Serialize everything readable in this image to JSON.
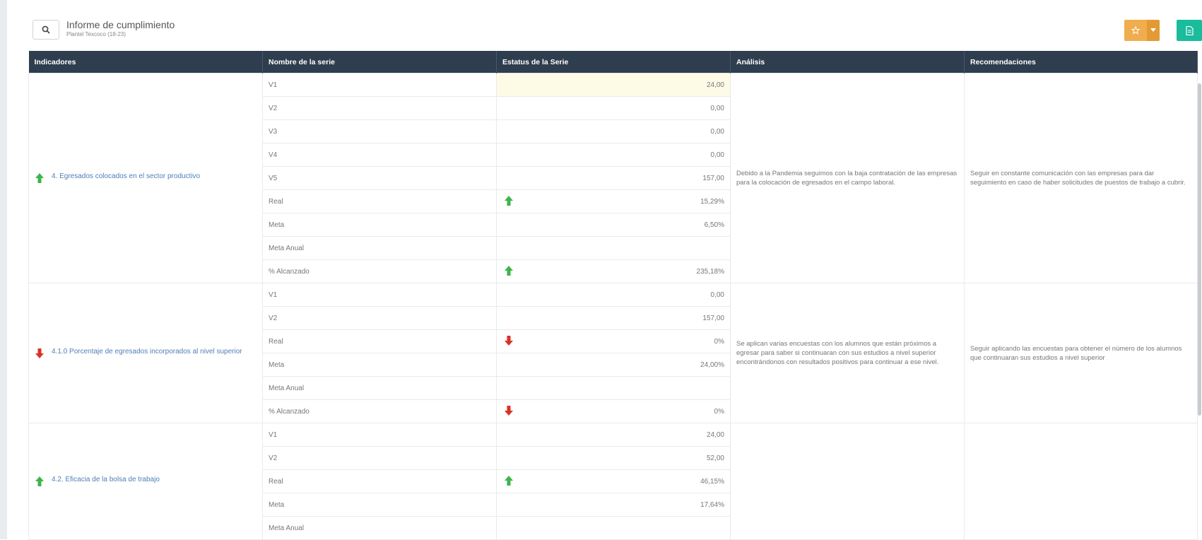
{
  "header": {
    "title": "Informe de cumplimiento",
    "subtitle": "Plantel Texcoco (18-23)"
  },
  "colors": {
    "header_bg": "#2f3e4e",
    "arrow_up": "#3bb54a",
    "arrow_down": "#d9322a",
    "star_button": "#f0ad4e",
    "doc_button": "#1abc9c",
    "link": "#4e7fb5"
  },
  "toolbar": {
    "search_icon": "search-icon",
    "star_icon": "star-icon",
    "caret_icon": "caret-down-icon",
    "doc_icon": "document-icon"
  },
  "table": {
    "columns": [
      "Indicadores",
      "Nombre de la serie",
      "Estatus de la Serie",
      "Análisis",
      "Recomendaciones"
    ],
    "groups": [
      {
        "indicator": "4. Egresados colocados en el sector productivo",
        "trend": "up",
        "analysis": "Debido a la Pandemia seguimos con la baja contratación de las empresas para la colocación de egresados en el campo laboral.",
        "recommendation": "Seguir en constante comunicación con las empresas para dar seguimiento en caso de haber solicitudes de puestos de trabajo a cubrir.",
        "rows": [
          {
            "serie": "V1",
            "value": "24,00",
            "status": "",
            "highlight": true
          },
          {
            "serie": "V2",
            "value": "0,00",
            "status": ""
          },
          {
            "serie": "V3",
            "value": "0,00",
            "status": ""
          },
          {
            "serie": "V4",
            "value": "0,00",
            "status": ""
          },
          {
            "serie": "V5",
            "value": "157,00",
            "status": ""
          },
          {
            "serie": "Real",
            "value": "15,29%",
            "status": "up"
          },
          {
            "serie": "Meta",
            "value": "6,50%",
            "status": ""
          },
          {
            "serie": "Meta Anual",
            "value": "",
            "status": ""
          },
          {
            "serie": "% Alcanzado",
            "value": "235,18%",
            "status": "up"
          }
        ]
      },
      {
        "indicator": "4.1.0 Porcentaje de egresados incorporados al nivel superior",
        "trend": "down",
        "analysis": "Se aplican varias encuestas con los alumnos que están próximos a egresar para saber si continuaran con sus estudios a nivel superior encontrándonos con resultados positivos para continuar a ese nivel.",
        "recommendation": "Seguir aplicando las encuestas para obtener el número de los alumnos que continuaran sus estudios a nivel superior",
        "rows": [
          {
            "serie": "V1",
            "value": "0,00",
            "status": ""
          },
          {
            "serie": "V2",
            "value": "157,00",
            "status": ""
          },
          {
            "serie": "Real",
            "value": "0%",
            "status": "down"
          },
          {
            "serie": "Meta",
            "value": "24,00%",
            "status": ""
          },
          {
            "serie": "Meta Anual",
            "value": "",
            "status": ""
          },
          {
            "serie": "% Alcanzado",
            "value": "0%",
            "status": "down"
          }
        ]
      },
      {
        "indicator": "4.2. Eficacia de la bolsa de trabajo",
        "trend": "up",
        "analysis": "",
        "recommendation": "",
        "rows": [
          {
            "serie": "V1",
            "value": "24,00",
            "status": ""
          },
          {
            "serie": "V2",
            "value": "52,00",
            "status": ""
          },
          {
            "serie": "Real",
            "value": "46,15%",
            "status": "up"
          },
          {
            "serie": "Meta",
            "value": "17,64%",
            "status": ""
          },
          {
            "serie": "Meta Anual",
            "value": "",
            "status": ""
          }
        ]
      }
    ]
  }
}
